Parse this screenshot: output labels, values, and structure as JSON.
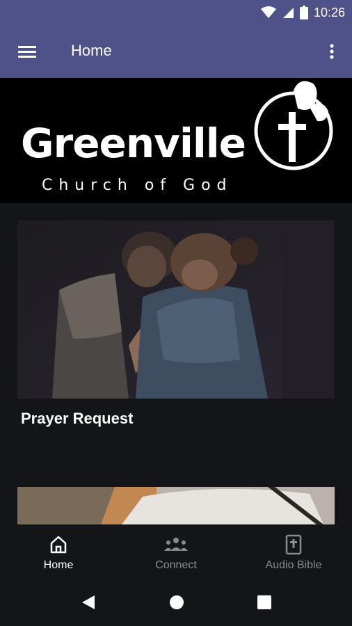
{
  "status_bar": {
    "time": "10:26"
  },
  "app_bar": {
    "title": "Home"
  },
  "banner": {
    "name": "Greenville",
    "subtitle": "Church of God"
  },
  "cards": [
    {
      "title": "Prayer Request"
    }
  ],
  "bottom_nav": {
    "items": [
      {
        "label": "Home",
        "icon": "home-icon",
        "active": true
      },
      {
        "label": "Connect",
        "icon": "people-icon",
        "active": false
      },
      {
        "label": "Audio Bible",
        "icon": "bible-icon",
        "active": false
      }
    ]
  },
  "colors": {
    "primary": "#4f5289",
    "background": "#141518"
  }
}
